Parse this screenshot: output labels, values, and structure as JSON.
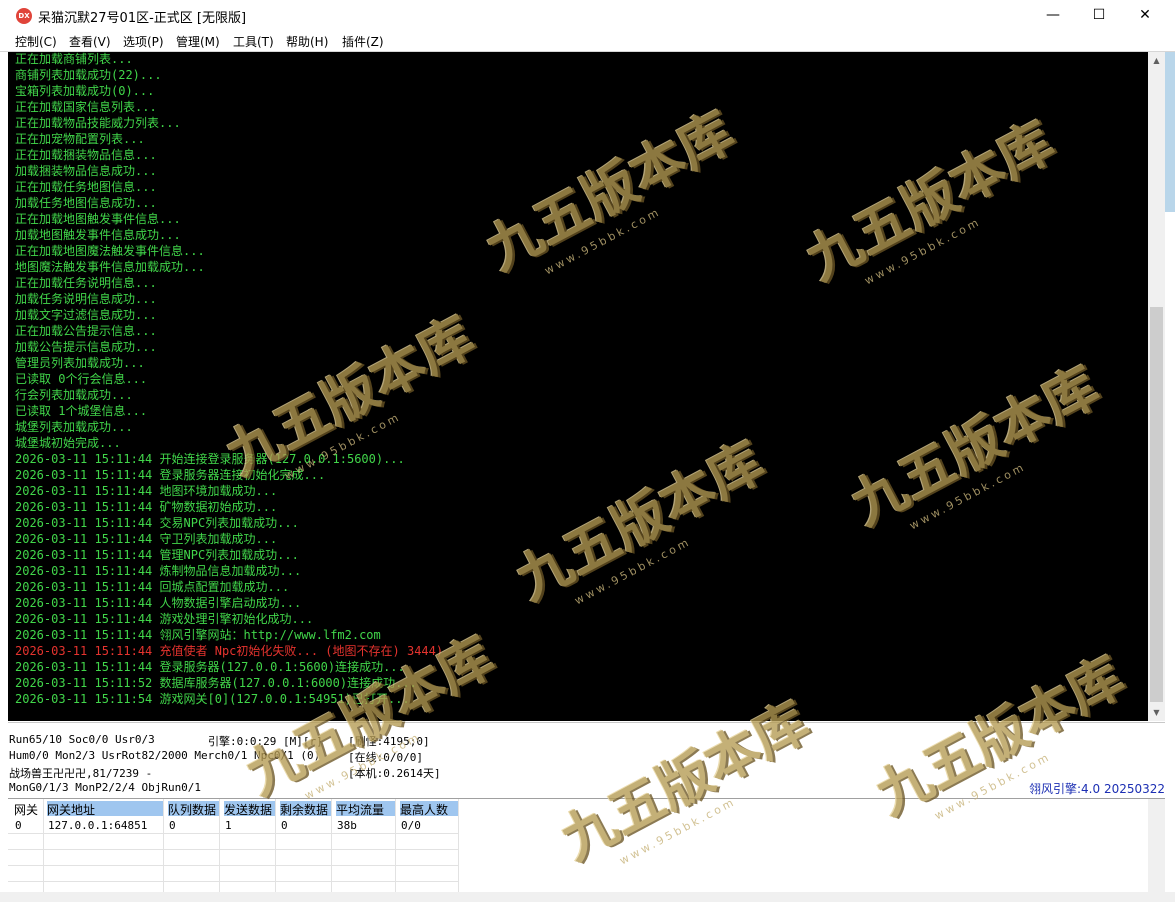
{
  "window": {
    "icon_text": "DX",
    "title": "呆猫沉默27号01区-正式区 [无限版]",
    "minimize_glyph": "—",
    "maximize_glyph": "☐",
    "close_glyph": "✕"
  },
  "menu": [
    "控制(C)",
    "查看(V)",
    "选项(P)",
    "管理(M)",
    "工具(T)",
    "帮助(H)",
    "插件(Z)"
  ],
  "log": [
    {
      "text": "正在加载商铺列表...",
      "type": "info"
    },
    {
      "text": "商铺列表加载成功(22)...",
      "type": "info"
    },
    {
      "text": "宝箱列表加载成功(0)...",
      "type": "info"
    },
    {
      "text": "正在加载国家信息列表...",
      "type": "info"
    },
    {
      "text": "正在加载物品技能威力列表...",
      "type": "info"
    },
    {
      "text": "正在加宠物配置列表...",
      "type": "info"
    },
    {
      "text": "正在加载捆装物品信息...",
      "type": "info"
    },
    {
      "text": "加载捆装物品信息成功...",
      "type": "info"
    },
    {
      "text": "正在加载任务地图信息...",
      "type": "info"
    },
    {
      "text": "加载任务地图信息成功...",
      "type": "info"
    },
    {
      "text": "正在加载地图触发事件信息...",
      "type": "info"
    },
    {
      "text": "加载地图触发事件信息成功...",
      "type": "info"
    },
    {
      "text": "正在加载地图魔法触发事件信息...",
      "type": "info"
    },
    {
      "text": "地图魔法触发事件信息加载成功...",
      "type": "info"
    },
    {
      "text": "正在加载任务说明信息...",
      "type": "info"
    },
    {
      "text": "加载任务说明信息成功...",
      "type": "info"
    },
    {
      "text": "加载文字过滤信息成功...",
      "type": "info"
    },
    {
      "text": "正在加载公告提示信息...",
      "type": "info"
    },
    {
      "text": "加载公告提示信息成功...",
      "type": "info"
    },
    {
      "text": "管理员列表加载成功...",
      "type": "info"
    },
    {
      "text": "已读取 0个行会信息...",
      "type": "info"
    },
    {
      "text": "行会列表加载成功...",
      "type": "info"
    },
    {
      "text": "已读取 1个城堡信息...",
      "type": "info"
    },
    {
      "text": "城堡列表加载成功...",
      "type": "info"
    },
    {
      "text": "城堡城初始完成...",
      "type": "info"
    },
    {
      "text": "2026-03-11 15:11:44 开始连接登录服务器(127.0.0.1:5600)...",
      "type": "info"
    },
    {
      "text": "2026-03-11 15:11:44 登录服务器连接初始化完成...",
      "type": "info"
    },
    {
      "text": "2026-03-11 15:11:44 地图环境加载成功...",
      "type": "info"
    },
    {
      "text": "2026-03-11 15:11:44 矿物数据初始成功...",
      "type": "info"
    },
    {
      "text": "2026-03-11 15:11:44 交易NPC列表加载成功...",
      "type": "info"
    },
    {
      "text": "2026-03-11 15:11:44 守卫列表加载成功...",
      "type": "info"
    },
    {
      "text": "2026-03-11 15:11:44 管理NPC列表加载成功...",
      "type": "info"
    },
    {
      "text": "2026-03-11 15:11:44 炼制物品信息加载成功...",
      "type": "info"
    },
    {
      "text": "2026-03-11 15:11:44 回城点配置加载成功...",
      "type": "info"
    },
    {
      "text": "2026-03-11 15:11:44 人物数据引擎启动成功...",
      "type": "info"
    },
    {
      "text": "2026-03-11 15:11:44 游戏处理引擎初始化成功...",
      "type": "info"
    },
    {
      "text": "2026-03-11 15:11:44 翎风引擎网站：http://www.lfm2.com",
      "type": "info"
    },
    {
      "text": "2026-03-11 15:11:44 充值使者 Npc初始化失败... (地图不存在) 3444)",
      "type": "error"
    },
    {
      "text": "2026-03-11 15:11:44 登录服务器(127.0.0.1:5600)连接成功...",
      "type": "info"
    },
    {
      "text": "2026-03-11 15:11:52 数据库服务器(127.0.0.1:6000)连接成功...",
      "type": "info"
    },
    {
      "text": "2026-03-11 15:11:54 游戏网关[0](127.0.0.1:54951)已打开...",
      "type": "info"
    }
  ],
  "status": {
    "line1_left": "Run65/10 Soc0/0 Usr0/3",
    "engine": "引擎:0:0:29 [M][r]",
    "refresh": "[刷怪:4195;0]",
    "line2_left": "Hum0/0 Mon2/3 UsrRot82/2000 Merch0/1 Npc0/1 (0)",
    "online": "[在线:0/0/0]",
    "line3_left": "战场兽王卍卍卍,81/7239 -",
    "local": "[本机:0.2614天]",
    "line4_left": "MonG0/1/3 MonP2/2/4 ObjRun0/1",
    "engine_version": "翎风引擎:4.0 20250322"
  },
  "gateway_table": {
    "headers": [
      "网关",
      "网关地址",
      "队列数据",
      "发送数据",
      "剩余数据",
      "平均流量",
      "最高人数"
    ],
    "rows": [
      [
        "0",
        "127.0.0.1:64851",
        "0",
        "1",
        "0",
        "38b",
        "0/0"
      ]
    ]
  },
  "watermark": {
    "main": "九五版本库",
    "sub": "www.95bbk.com"
  },
  "colors": {
    "console_bg": "#000000",
    "log_info": "#41d64a",
    "log_error": "#e5332e",
    "engine_version": "#1c2fb3"
  }
}
